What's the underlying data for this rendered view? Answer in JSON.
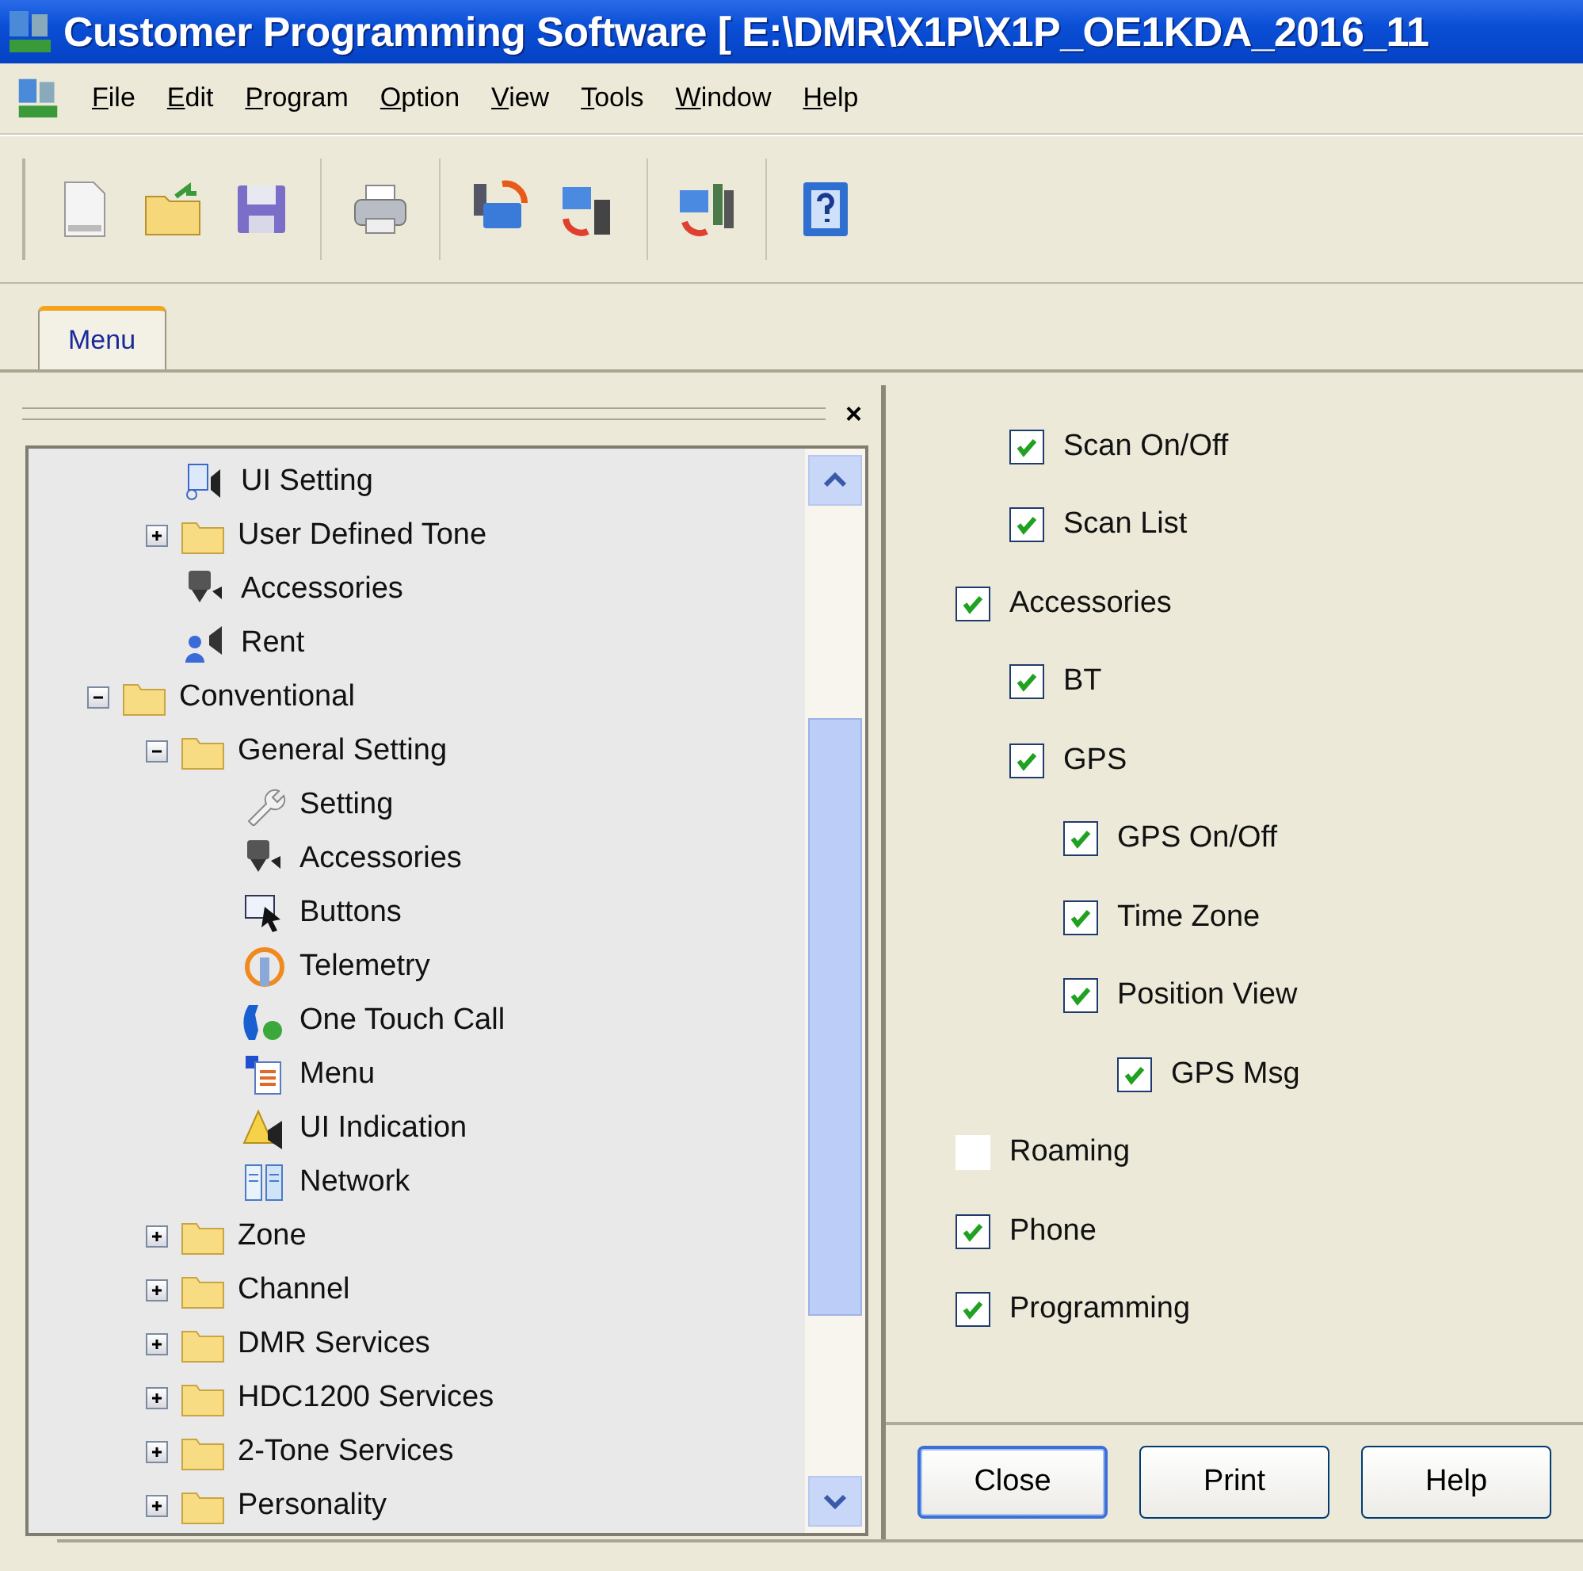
{
  "window": {
    "title": "Customer Programming Software [ E:\\DMR\\X1P\\X1P_OE1KDA_2016_11"
  },
  "menu_bar": [
    "File",
    "Edit",
    "Program",
    "Option",
    "View",
    "Tools",
    "Window",
    "Help"
  ],
  "toolbar": [
    [
      {
        "kind": "new"
      },
      {
        "kind": "open"
      },
      {
        "kind": "save"
      }
    ],
    [
      {
        "kind": "print"
      }
    ],
    [
      {
        "kind": "read"
      },
      {
        "kind": "write"
      }
    ],
    [
      {
        "kind": "clone"
      }
    ],
    [
      {
        "kind": "help"
      }
    ]
  ],
  "tabs": [
    {
      "label": "Menu",
      "selected": true
    }
  ],
  "tree": {
    "close": "×",
    "items": [
      {
        "children": [
          {
            "label": "UI Setting",
            "kind": "ui"
          },
          {
            "label": "User Defined Tone",
            "kind": "folder",
            "expanded": false
          },
          {
            "label": "Accessories",
            "kind": "accessory"
          },
          {
            "label": "Rent",
            "kind": "rent"
          }
        ]
      },
      {
        "label": "Conventional",
        "kind": "folder",
        "expanded": true,
        "children": [
          {
            "label": "General Setting",
            "kind": "folder",
            "expanded": true,
            "children": [
              {
                "label": "Setting",
                "kind": "wrench"
              },
              {
                "label": "Accessories",
                "kind": "accessory"
              },
              {
                "label": "Buttons",
                "kind": "buttons"
              },
              {
                "label": "Telemetry",
                "kind": "telemetry"
              },
              {
                "label": "One Touch Call",
                "kind": "phone"
              },
              {
                "label": "Menu",
                "kind": "menu"
              },
              {
                "label": "UI Indication",
                "kind": "warning"
              },
              {
                "label": "Network",
                "kind": "network"
              }
            ]
          },
          {
            "label": "Zone",
            "kind": "folder",
            "expanded": false
          },
          {
            "label": "Channel",
            "kind": "folder",
            "expanded": false
          },
          {
            "label": "DMR Services",
            "kind": "folder",
            "expanded": false
          },
          {
            "label": "HDC1200 Services",
            "kind": "folder",
            "expanded": false
          },
          {
            "label": "2-Tone Services",
            "kind": "folder",
            "expanded": false
          },
          {
            "label": "Personality",
            "kind": "folder",
            "expanded": false
          }
        ]
      }
    ]
  },
  "options": [
    {
      "children": [
        {
          "label": "Scan On/Off",
          "checked": true
        },
        {
          "label": "Scan List",
          "checked": true
        }
      ]
    },
    {
      "label": "Accessories",
      "checked": true,
      "children": [
        {
          "label": "BT",
          "checked": true
        },
        {
          "label": "GPS",
          "checked": true,
          "children": [
            {
              "label": "GPS On/Off",
              "checked": true
            },
            {
              "label": "Time Zone",
              "checked": true
            },
            {
              "label": "Position View",
              "checked": true,
              "children": [
                {
                  "label": "GPS Msg",
                  "checked": true
                }
              ]
            }
          ]
        }
      ]
    },
    {
      "label": "Roaming",
      "checked": false
    },
    {
      "label": "Phone",
      "checked": true
    },
    {
      "label": "Programming",
      "checked": true
    }
  ],
  "buttons": [
    {
      "label": "Close",
      "default": true
    },
    {
      "label": "Print",
      "default": false
    },
    {
      "label": "Help",
      "default": false
    }
  ]
}
